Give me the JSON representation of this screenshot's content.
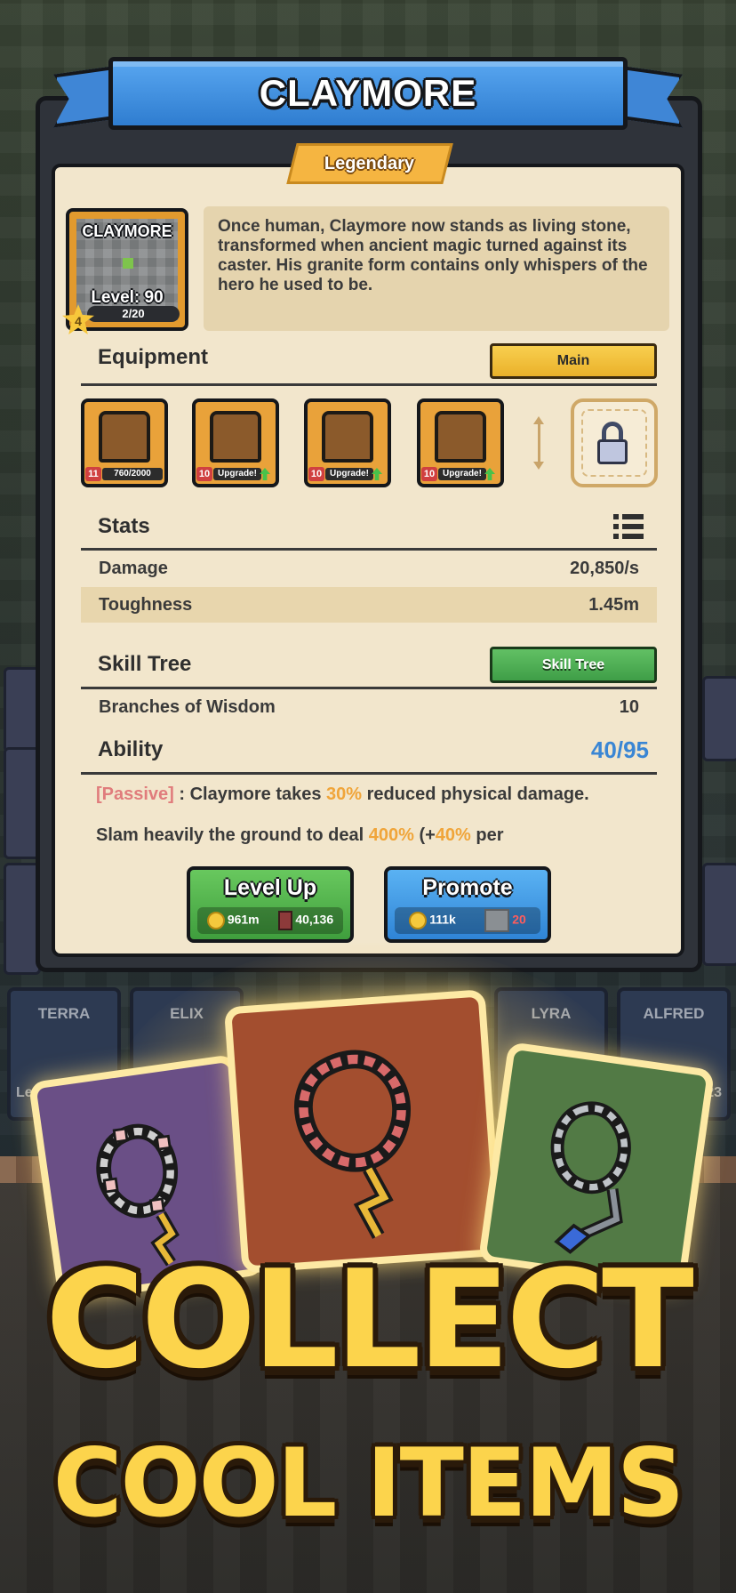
{
  "hero": {
    "name": "CLAYMORE",
    "rarity": "Legendary",
    "portrait_name": "CLAYMORE",
    "level": "Level: 90",
    "xp": "2/20",
    "stars": "4",
    "description": "Once human, Claymore now stands as living stone, transformed when ancient magic turned against its caster. His granite form contains only whispers of the hero he used to be."
  },
  "equipment": {
    "title": "Equipment",
    "main_button": "Main",
    "slots": [
      {
        "icon": "helmet-armor-icon",
        "level": "11",
        "progress": "760/2000",
        "upgradable": false
      },
      {
        "icon": "gloves-icon",
        "level": "10",
        "progress": "Upgrade!",
        "upgradable": true
      },
      {
        "icon": "horned-helmet-icon",
        "level": "10",
        "progress": "Upgrade!",
        "upgradable": true
      },
      {
        "icon": "hood-icon",
        "level": "10",
        "progress": "Upgrade!",
        "upgradable": true
      }
    ],
    "locked_slot_icon": "padlock-icon"
  },
  "stats": {
    "title": "Stats",
    "rows": [
      {
        "label": "Damage",
        "value": "20,850/s"
      },
      {
        "label": "Toughness",
        "value": "1.45m"
      }
    ]
  },
  "skill_tree": {
    "title": "Skill Tree",
    "button": "Skill Tree",
    "branch_label": "Branches of Wisdom",
    "branch_value": "10"
  },
  "ability": {
    "title": "Ability",
    "value": "40/95",
    "passive_tag": "[Passive]",
    "passive_pre": " : Claymore takes ",
    "passive_pct": "30%",
    "passive_post": " reduced physical damage.",
    "slam_pre": "Slam heavily the ground to deal ",
    "slam_pct1": "400%",
    "slam_mid": " (+",
    "slam_pct2": "40%",
    "slam_post": " per"
  },
  "actions": {
    "level_up": {
      "label": "Level Up",
      "gold": "961m",
      "books": "40,136"
    },
    "promote": {
      "label": "Promote",
      "gold": "111k",
      "shards": "20"
    }
  },
  "background": {
    "cards": [
      {
        "name": "TERRA",
        "level": "Level: 100"
      },
      {
        "name": "ELIX",
        "level": ""
      },
      {
        "name": "LYRA",
        "level": ""
      },
      {
        "name": "ALFRED",
        "level": "vel: 23"
      }
    ]
  },
  "promo": {
    "line1": "COLLECT",
    "line2": "COOL ITEMS"
  },
  "colors": {
    "ribbon_blue": "#3f86d6",
    "panel_cream": "#f2e6cc",
    "accent_orange": "#f0a53a",
    "ability_blue": "#3a86d4",
    "button_green": "#4fae4f",
    "headline_yellow": "#fcd44c"
  }
}
